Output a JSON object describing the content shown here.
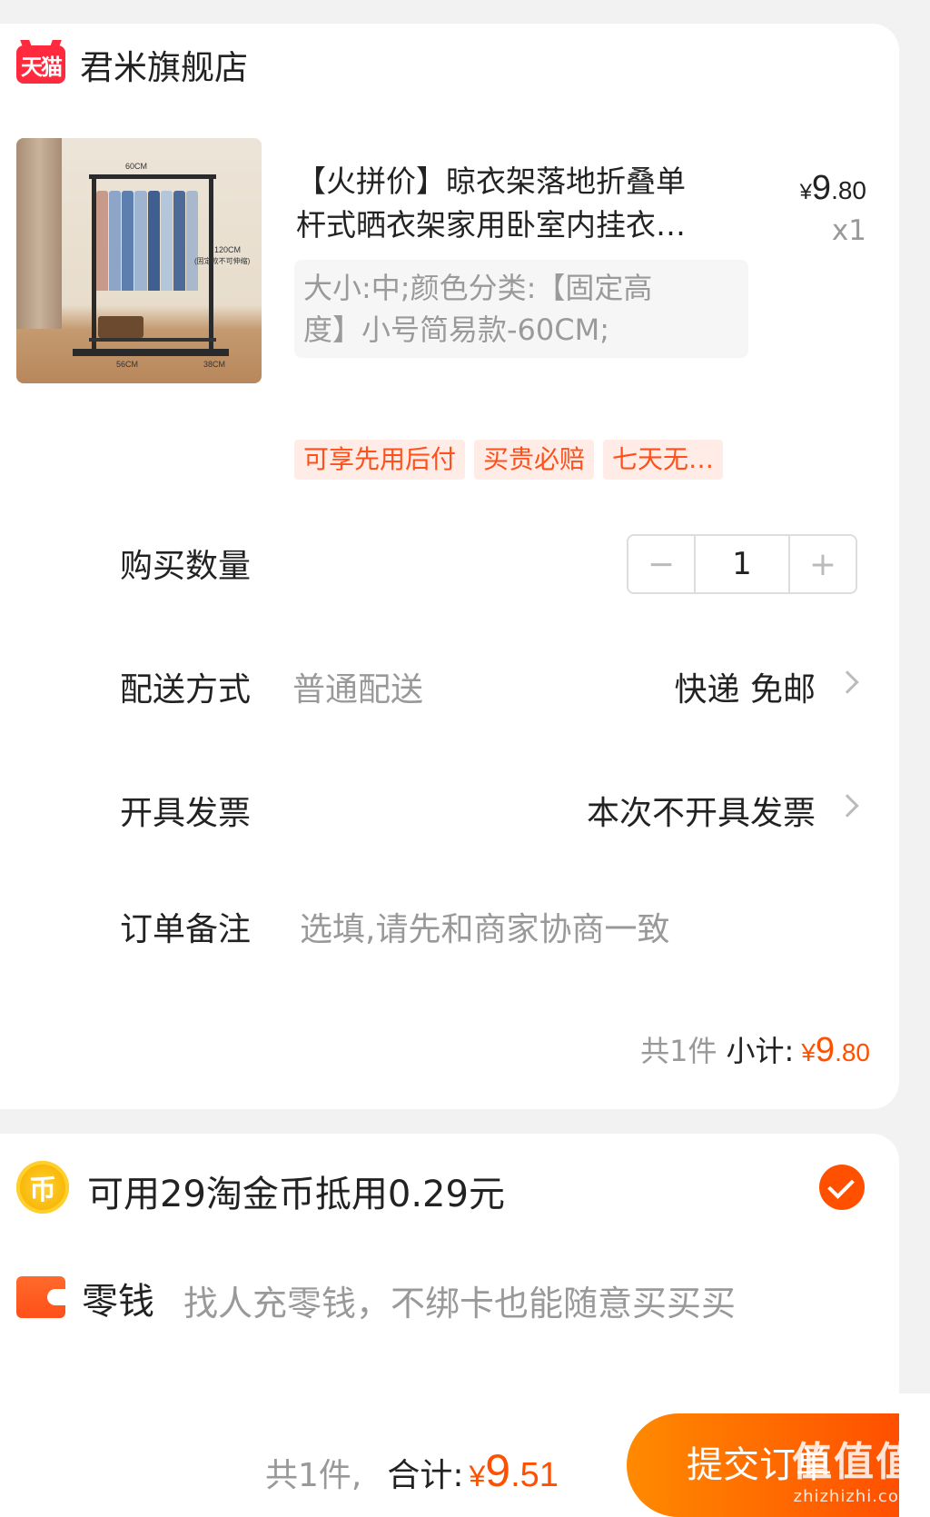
{
  "shop": {
    "logo_text": "天猫",
    "name": "君米旗舰店"
  },
  "product": {
    "image_name": "clothes-rack-photo",
    "image_labels": {
      "top": "60CM",
      "side": "120CM",
      "side_note": "(固定款不可伸缩)",
      "bottom": "56CM",
      "depth": "38CM"
    },
    "title_line1": "【火拼价】晾衣架落地折叠单",
    "title_line2": "杆式晒衣架家用卧室内挂衣…",
    "price_symbol": "¥",
    "price_int": "9",
    "price_dec": ".80",
    "qty_label": "x1",
    "sku_line1": "大小:中;颜色分类:【固定高",
    "sku_line2": "度】小号简易款-60CM;",
    "tags": [
      "可享先用后付",
      "买贵必赔",
      "七天无…"
    ]
  },
  "quantity": {
    "label": "购买数量",
    "minus": "−",
    "value": "1",
    "plus": "+"
  },
  "delivery": {
    "label": "配送方式",
    "sub": "普通配送",
    "value": "快递 免邮"
  },
  "invoice": {
    "label": "开具发票",
    "value": "本次不开具发票"
  },
  "note": {
    "label": "订单备注",
    "placeholder": "选填,请先和商家协商一致"
  },
  "subtotal": {
    "count": "共1件",
    "label": "小计:",
    "symbol": "¥",
    "int": "9",
    "dec": ".80"
  },
  "coins": {
    "icon_char": "币",
    "text": "可用29淘金币抵用0.29元",
    "checked": true
  },
  "wallet": {
    "label": "零钱",
    "hint": "找人充零钱，不绑卡也能随意买买买"
  },
  "footer": {
    "count": "共1件,",
    "label": "合计:",
    "symbol": "¥",
    "int": "9",
    "dec": ".51",
    "submit_label": "提交订单",
    "watermark_cn": "值值值",
    "watermark_en": "zhizhizhi.com"
  },
  "colors": {
    "accent": "#ff5000",
    "tag_bg": "#ffece6",
    "tmall_red": "#ff2a3e",
    "coin_gold": "#f8b400"
  }
}
